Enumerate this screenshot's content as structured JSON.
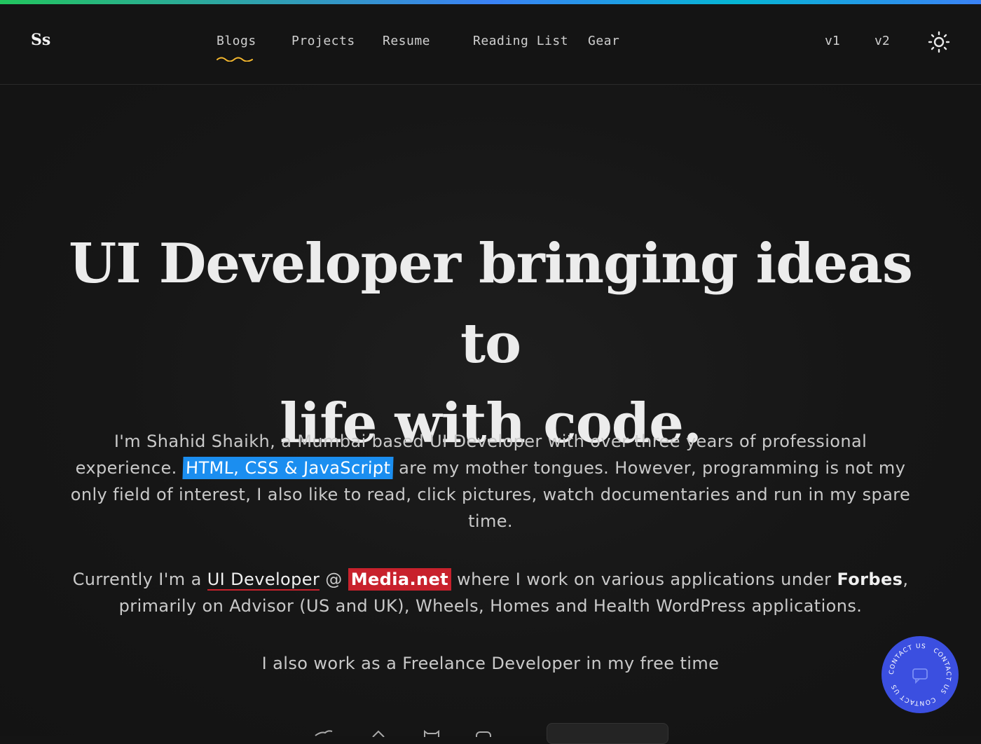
{
  "header": {
    "logo": "Ss",
    "nav": [
      {
        "label": "Blogs",
        "active": true
      },
      {
        "label": "Projects"
      },
      {
        "label": "Resume"
      },
      {
        "label": "Reading List"
      },
      {
        "label": "Gear"
      }
    ],
    "versions": [
      "v1",
      "v2"
    ],
    "theme_icon": "sun-icon"
  },
  "hero": {
    "title_line1": "UI Developer bringing ideas to",
    "title_line2": "life with code.",
    "intro": {
      "part1": "I'm Shahid Shaikh, a Mumbai based UI Developer with over three years of professional experience.",
      "highlight": "HTML, CSS & JavaScript",
      "part2": "are my mother tongues. However, programming is not my only field of interest, I also like to read, click pictures, watch documentaries and run in my spare time."
    },
    "current": {
      "prefix": "Currently I'm a",
      "role": "UI Developer",
      "at": "@",
      "company": "Media.net",
      "middle": "where I work on various applications under",
      "client": "Forbes",
      "suffix": ", primarily on Advisor (US and UK), Wheels, Homes and Health WordPress applications."
    },
    "freelance": "I also work as a Freelance Developer in my free time"
  },
  "contact_badge": {
    "label": "CONTACT US",
    "color": "#3b4fe0"
  },
  "colors": {
    "accent_blue": "#1b8ef0",
    "accent_red": "#c8212c",
    "nav_underline": "#f5b82e"
  }
}
